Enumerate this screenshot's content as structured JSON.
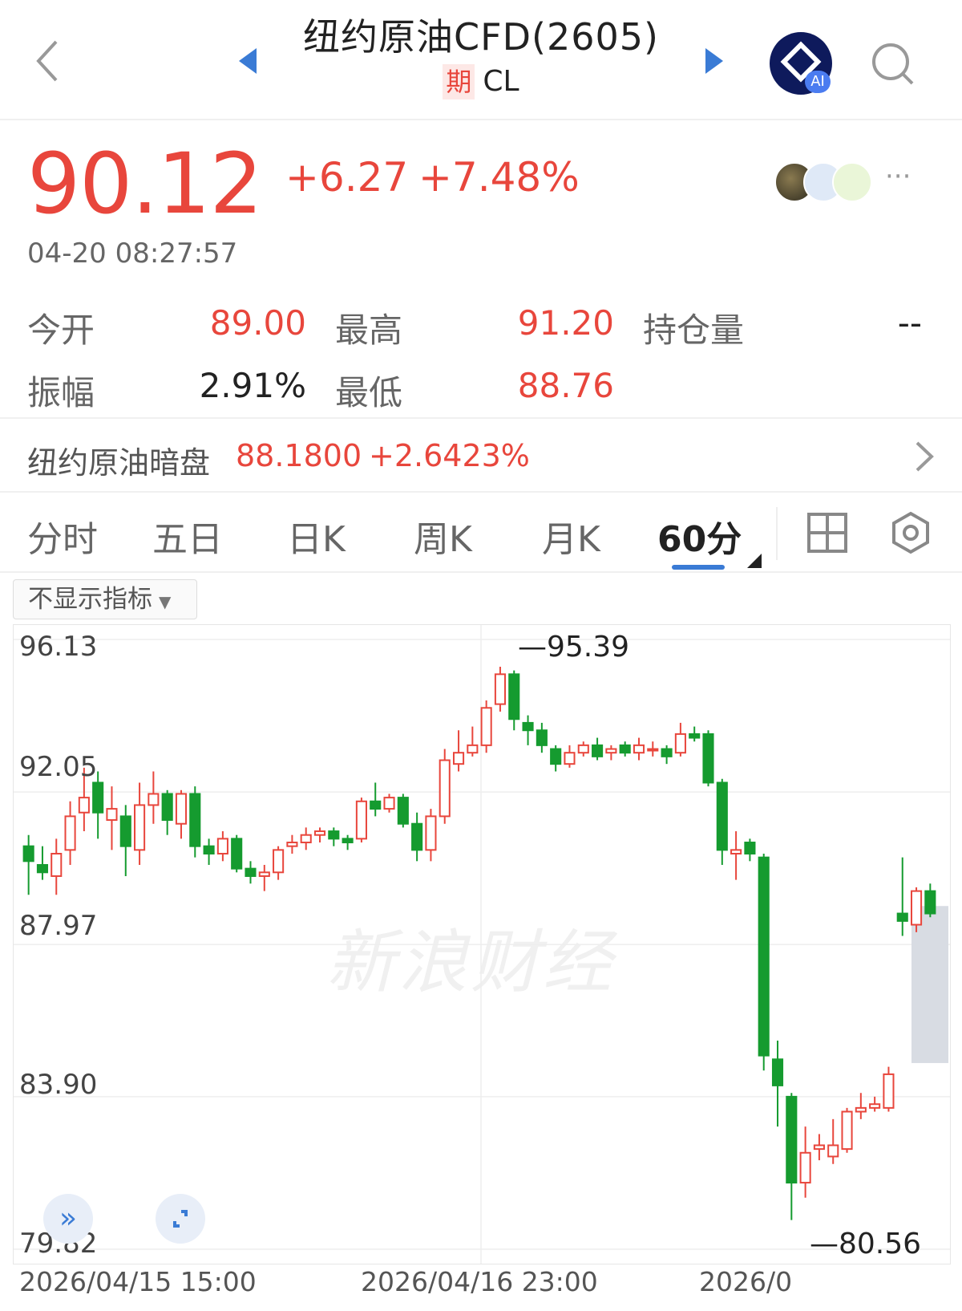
{
  "header": {
    "title": "纽约原油CFD(2605)",
    "tag": "期",
    "code": "CL",
    "ai_label": "AI"
  },
  "quote": {
    "price": "90.12",
    "change": "+6.27",
    "change_pct": "+7.48%",
    "time": "04-20 08:27:57",
    "more": "···"
  },
  "stats": [
    {
      "label": "今开",
      "value": "89.00"
    },
    {
      "label": "最高",
      "value": "91.20"
    },
    {
      "label": "持仓量",
      "value": "--"
    },
    {
      "label": "振幅",
      "value": "2.91%"
    },
    {
      "label": "最低",
      "value": "88.76"
    }
  ],
  "dark_pool": {
    "label": "纽约原油暗盘",
    "price": "88.1800",
    "change_pct": "+2.6423%"
  },
  "tabs": [
    "分时",
    "五日",
    "日K",
    "周K",
    "月K",
    "60分"
  ],
  "active_tab": "60分",
  "indicator_select": "不显示指标",
  "watermark": "新浪财经",
  "colors": {
    "up": "#e8463c",
    "down": "#159b2f",
    "accent": "#3a7bd5"
  },
  "chart_data": {
    "type": "candlestick",
    "interval": "60分",
    "y_ticks": [
      "96.13",
      "92.05",
      "87.97",
      "83.90",
      "79.82"
    ],
    "ylim": [
      79.82,
      96.13
    ],
    "x_ticks": [
      "2026/04/15 15:00",
      "2026/04/16 23:00",
      "2026/0"
    ],
    "annotations": {
      "high": "95.39",
      "low": "80.56"
    },
    "candles": [
      [
        90.6,
        90.2,
        90.9,
        89.3
      ],
      [
        90.1,
        89.9,
        90.6,
        89.7
      ],
      [
        89.8,
        90.4,
        90.8,
        89.3
      ],
      [
        90.5,
        91.4,
        91.8,
        90.1
      ],
      [
        91.5,
        91.9,
        92.7,
        91.0
      ],
      [
        92.3,
        91.5,
        92.6,
        90.8
      ],
      [
        91.3,
        91.6,
        92.2,
        90.5
      ],
      [
        91.4,
        90.6,
        91.7,
        89.8
      ],
      [
        90.5,
        91.7,
        92.3,
        90.1
      ],
      [
        91.7,
        92.0,
        92.6,
        91.2
      ],
      [
        92.0,
        91.3,
        92.1,
        90.9
      ],
      [
        91.2,
        92.0,
        92.1,
        90.8
      ],
      [
        92.0,
        90.6,
        92.2,
        90.3
      ],
      [
        90.6,
        90.4,
        90.8,
        90.1
      ],
      [
        90.4,
        90.8,
        91.0,
        90.2
      ],
      [
        90.8,
        90.0,
        90.9,
        89.9
      ],
      [
        90.0,
        89.8,
        90.2,
        89.6
      ],
      [
        89.8,
        89.9,
        90.1,
        89.4
      ],
      [
        89.9,
        90.5,
        90.6,
        89.7
      ],
      [
        90.6,
        90.7,
        90.9,
        90.4
      ],
      [
        90.7,
        90.9,
        91.1,
        90.5
      ],
      [
        90.9,
        91.0,
        91.1,
        90.7
      ],
      [
        91.0,
        90.8,
        91.1,
        90.6
      ],
      [
        90.8,
        90.7,
        90.9,
        90.5
      ],
      [
        90.8,
        91.8,
        91.9,
        90.7
      ],
      [
        91.8,
        91.6,
        92.3,
        91.4
      ],
      [
        91.6,
        91.9,
        92.0,
        91.5
      ],
      [
        91.9,
        91.2,
        92.0,
        91.1
      ],
      [
        91.2,
        90.5,
        91.5,
        90.2
      ],
      [
        90.5,
        91.4,
        91.6,
        90.2
      ],
      [
        91.4,
        92.9,
        93.2,
        91.2
      ],
      [
        92.8,
        93.1,
        93.7,
        92.6
      ],
      [
        93.1,
        93.3,
        93.8,
        93.0
      ],
      [
        93.3,
        94.3,
        94.5,
        93.1
      ],
      [
        94.4,
        95.2,
        95.4,
        94.2
      ],
      [
        95.2,
        94.0,
        95.3,
        93.7
      ],
      [
        93.9,
        93.7,
        94.1,
        93.3
      ],
      [
        93.7,
        93.3,
        93.9,
        93.1
      ],
      [
        93.2,
        92.8,
        93.3,
        92.6
      ],
      [
        92.8,
        93.1,
        93.3,
        92.7
      ],
      [
        93.1,
        93.3,
        93.4,
        93.0
      ],
      [
        93.3,
        93.0,
        93.5,
        92.9
      ],
      [
        93.1,
        93.2,
        93.3,
        92.9
      ],
      [
        93.3,
        93.1,
        93.4,
        93.0
      ],
      [
        93.1,
        93.3,
        93.5,
        92.9
      ],
      [
        93.2,
        93.2,
        93.4,
        93.0
      ],
      [
        93.2,
        93.0,
        93.3,
        92.8
      ],
      [
        93.1,
        93.6,
        93.9,
        93.0
      ],
      [
        93.6,
        93.5,
        93.8,
        93.4
      ],
      [
        93.6,
        92.3,
        93.7,
        92.2
      ],
      [
        92.3,
        90.5,
        92.4,
        90.1
      ],
      [
        90.4,
        90.5,
        91.0,
        89.7
      ],
      [
        90.7,
        90.4,
        90.8,
        90.2
      ],
      [
        90.3,
        85.0,
        90.4,
        84.6
      ],
      [
        84.9,
        84.2,
        85.4,
        83.1
      ],
      [
        83.9,
        81.6,
        84.0,
        80.6
      ],
      [
        81.6,
        82.4,
        83.1,
        81.2
      ],
      [
        82.5,
        82.6,
        82.9,
        82.2
      ],
      [
        82.3,
        82.6,
        83.3,
        82.1
      ],
      [
        82.5,
        83.5,
        83.6,
        82.4
      ],
      [
        83.5,
        83.6,
        84.0,
        83.3
      ],
      [
        83.6,
        83.7,
        83.9,
        83.5
      ],
      [
        83.6,
        84.5,
        84.7,
        83.5
      ],
      [
        88.8,
        88.6,
        90.3,
        88.2
      ],
      [
        88.5,
        89.4,
        89.5,
        88.3
      ],
      [
        89.4,
        88.8,
        89.6,
        88.7
      ]
    ]
  }
}
